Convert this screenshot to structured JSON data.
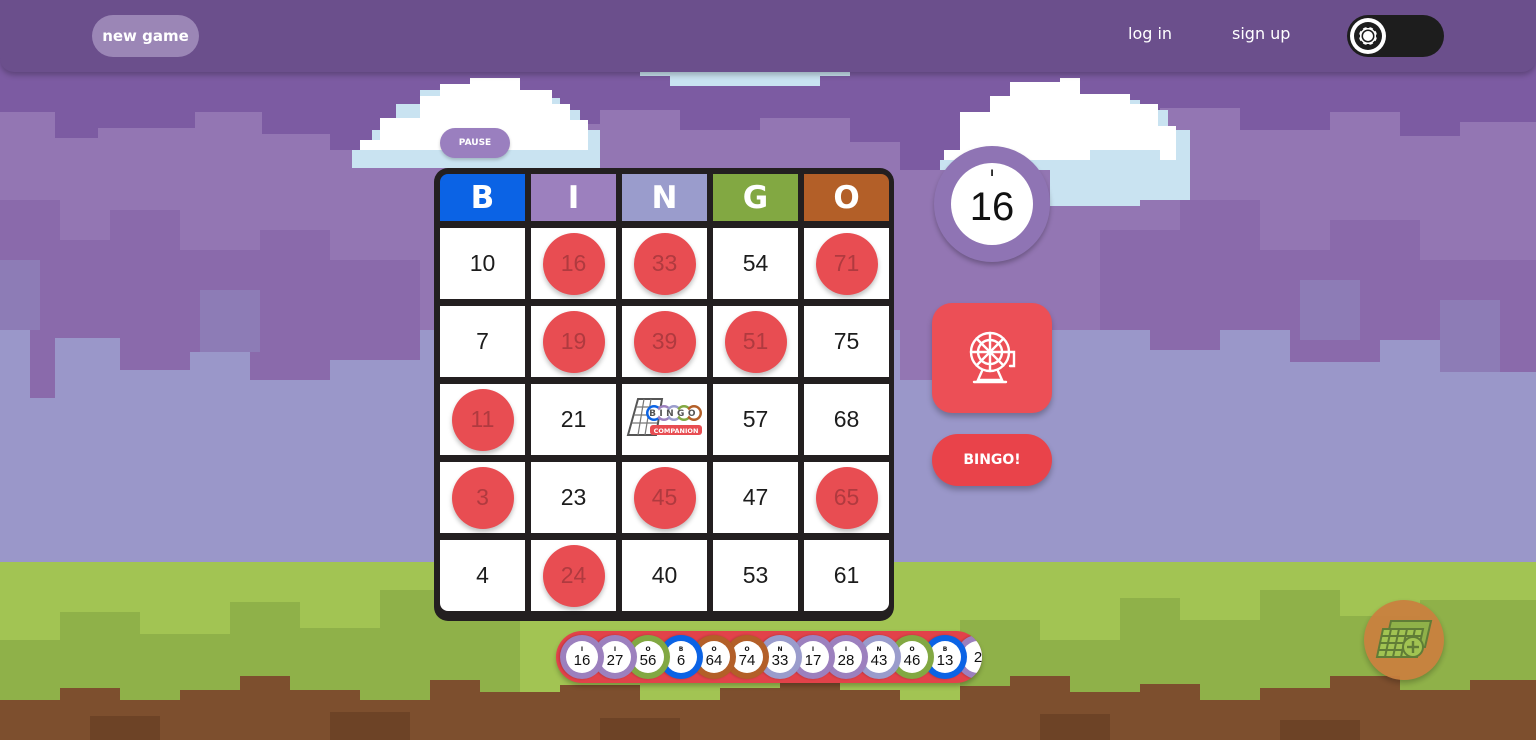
{
  "header": {
    "new_game_label": "new game",
    "login_label": "log in",
    "signup_label": "sign up"
  },
  "pause_label": "PAUSE",
  "card": {
    "columns": [
      "B",
      "I",
      "N",
      "G",
      "O"
    ],
    "rows": [
      [
        {
          "n": "10",
          "m": false
        },
        {
          "n": "16",
          "m": true
        },
        {
          "n": "33",
          "m": true
        },
        {
          "n": "54",
          "m": false
        },
        {
          "n": "71",
          "m": true
        }
      ],
      [
        {
          "n": "7",
          "m": false
        },
        {
          "n": "19",
          "m": true
        },
        {
          "n": "39",
          "m": true
        },
        {
          "n": "51",
          "m": true
        },
        {
          "n": "75",
          "m": false
        }
      ],
      [
        {
          "n": "11",
          "m": true
        },
        {
          "n": "21",
          "m": false
        },
        {
          "n": "FREE",
          "m": false
        },
        {
          "n": "57",
          "m": false
        },
        {
          "n": "68",
          "m": false
        }
      ],
      [
        {
          "n": "3",
          "m": true
        },
        {
          "n": "23",
          "m": false
        },
        {
          "n": "45",
          "m": true
        },
        {
          "n": "47",
          "m": false
        },
        {
          "n": "65",
          "m": true
        }
      ],
      [
        {
          "n": "4",
          "m": false
        },
        {
          "n": "24",
          "m": true
        },
        {
          "n": "40",
          "m": false
        },
        {
          "n": "53",
          "m": false
        },
        {
          "n": "61",
          "m": false
        }
      ]
    ],
    "free_space_text": {
      "word": "BINGO",
      "sub": "COMPANION"
    }
  },
  "current_ball": {
    "letter": "I",
    "number": "16"
  },
  "bingo_label": "BINGO!",
  "history": [
    {
      "letter": "I",
      "number": "16",
      "color": "#9c80be"
    },
    {
      "letter": "I",
      "number": "27",
      "color": "#9c80be"
    },
    {
      "letter": "O",
      "number": "56",
      "color": "#82a842"
    },
    {
      "letter": "B",
      "number": "6",
      "color": "#0b63e5"
    },
    {
      "letter": "O",
      "number": "64",
      "color": "#b35f28"
    },
    {
      "letter": "O",
      "number": "74",
      "color": "#b35f28"
    },
    {
      "letter": "N",
      "number": "33",
      "color": "#9a9ccc"
    },
    {
      "letter": "I",
      "number": "17",
      "color": "#9c80be"
    },
    {
      "letter": "I",
      "number": "28",
      "color": "#9c80be"
    },
    {
      "letter": "N",
      "number": "43",
      "color": "#9a9ccc"
    },
    {
      "letter": "O",
      "number": "46",
      "color": "#82a842"
    },
    {
      "letter": "B",
      "number": "13",
      "color": "#0b63e5"
    },
    {
      "letter": "",
      "number": "2",
      "color": "#9c80be"
    }
  ],
  "colors": {
    "B": "#0b63e5",
    "I": "#9c80be",
    "N": "#9a9ccc",
    "G": "#82a842",
    "O": "#b35f28",
    "dauber": "#e84d52",
    "accent": "#6b4f8c"
  },
  "icons": {
    "theme_toggle": "gear-icon",
    "draw_button": "bingo-cage-icon",
    "add_card": "add-card-icon"
  }
}
